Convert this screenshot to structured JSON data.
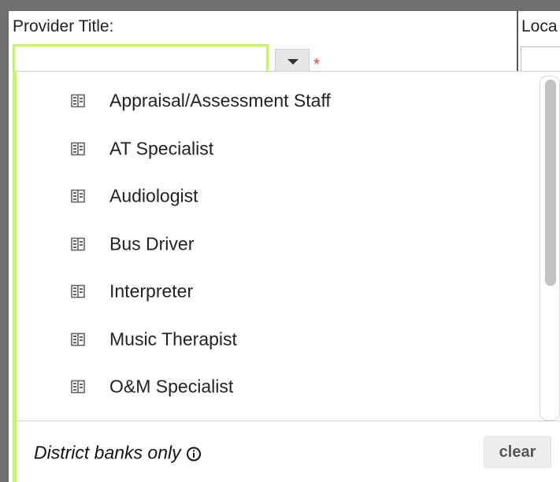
{
  "field": {
    "label": "Provider Title:",
    "value": "",
    "required_marker": "*"
  },
  "location": {
    "label_partial": "Loca"
  },
  "dropdown": {
    "items": [
      {
        "label": "Appraisal/Assessment Staff",
        "icon": "building-icon"
      },
      {
        "label": "AT Specialist",
        "icon": "building-icon"
      },
      {
        "label": "Audiologist",
        "icon": "building-icon"
      },
      {
        "label": "Bus Driver",
        "icon": "building-icon"
      },
      {
        "label": "Interpreter",
        "icon": "building-icon"
      },
      {
        "label": "Music Therapist",
        "icon": "building-icon"
      },
      {
        "label": "O&M Specialist",
        "icon": "building-icon"
      }
    ],
    "footer_text": "District banks only",
    "clear_label": "clear"
  },
  "colors": {
    "focus_border": "#c6f078",
    "required": "#e53935",
    "frame": "#6f6f6f"
  }
}
